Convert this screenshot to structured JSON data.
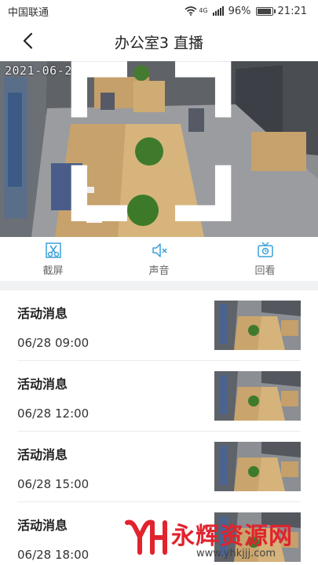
{
  "status_bar": {
    "carrier": "中国联通",
    "network": "4G",
    "battery": "96%",
    "time": "21:21"
  },
  "nav": {
    "title": "办公室3 直播",
    "back_icon": "chevron-left-icon"
  },
  "video": {
    "timestamp_overlay": "2021-06-28 21:20",
    "fullscreen_icon": "expand-icon"
  },
  "controls": [
    {
      "label": "截屏",
      "icon": "scissors-icon",
      "color": "#3aa0d8"
    },
    {
      "label": "声音",
      "icon": "speaker-muted-icon",
      "color": "#3aa0d8"
    },
    {
      "label": "回看",
      "icon": "tv-playback-icon",
      "color": "#3aa0d8"
    }
  ],
  "messages": [
    {
      "title": "活动消息",
      "time": "06/28 09:00"
    },
    {
      "title": "活动消息",
      "time": "06/28 12:00"
    },
    {
      "title": "活动消息",
      "time": "06/28 15:00"
    },
    {
      "title": "活动消息",
      "time": "06/28 18:00"
    }
  ],
  "watermark": {
    "brand": "永辉资源网",
    "url": "www.yhkjjj.com",
    "color": "#e1232e"
  }
}
